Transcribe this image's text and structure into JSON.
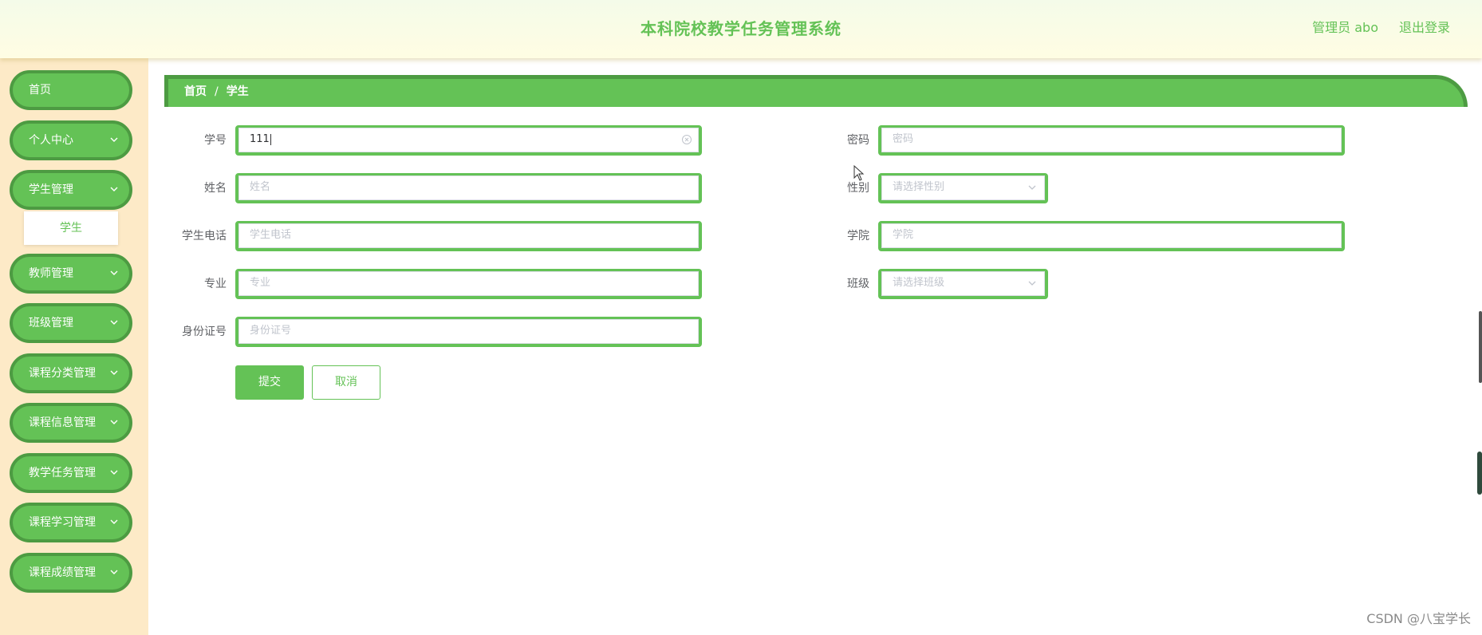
{
  "header": {
    "title": "本科院校教学任务管理系统",
    "user": "管理员 abo",
    "logout": "退出登录"
  },
  "sidebar": {
    "items": [
      {
        "label": "首页",
        "has_chevron": false
      },
      {
        "label": "个人中心",
        "has_chevron": true
      },
      {
        "label": "学生管理",
        "has_chevron": true
      },
      {
        "label": "教师管理",
        "has_chevron": true
      },
      {
        "label": "班级管理",
        "has_chevron": true
      },
      {
        "label": "课程分类管理",
        "has_chevron": true
      },
      {
        "label": "课程信息管理",
        "has_chevron": true
      },
      {
        "label": "教学任务管理",
        "has_chevron": true
      },
      {
        "label": "课程学习管理",
        "has_chevron": true
      },
      {
        "label": "课程成绩管理",
        "has_chevron": true
      }
    ],
    "submenu": {
      "label": "学生"
    }
  },
  "breadcrumb": {
    "home": "首页",
    "separator": "/",
    "current": "学生"
  },
  "form": {
    "student_no": {
      "label": "学号",
      "value": "111"
    },
    "password": {
      "label": "密码",
      "placeholder": "密码"
    },
    "name": {
      "label": "姓名",
      "placeholder": "姓名"
    },
    "gender": {
      "label": "性别",
      "placeholder": "请选择性别"
    },
    "phone": {
      "label": "学生电话",
      "placeholder": "学生电话"
    },
    "college": {
      "label": "学院",
      "placeholder": "学院"
    },
    "major": {
      "label": "专业",
      "placeholder": "专业"
    },
    "class": {
      "label": "班级",
      "placeholder": "请选择班级"
    },
    "id_card": {
      "label": "身份证号",
      "placeholder": "身份证号"
    },
    "submit": "提交",
    "cancel": "取消"
  },
  "watermark": "CSDN @八宝学长",
  "colors": {
    "accent": "#64c256",
    "accent_dark": "#4d9b42",
    "sidebar_bg": "#fdeac7",
    "header_bg": "#fdfce6"
  }
}
